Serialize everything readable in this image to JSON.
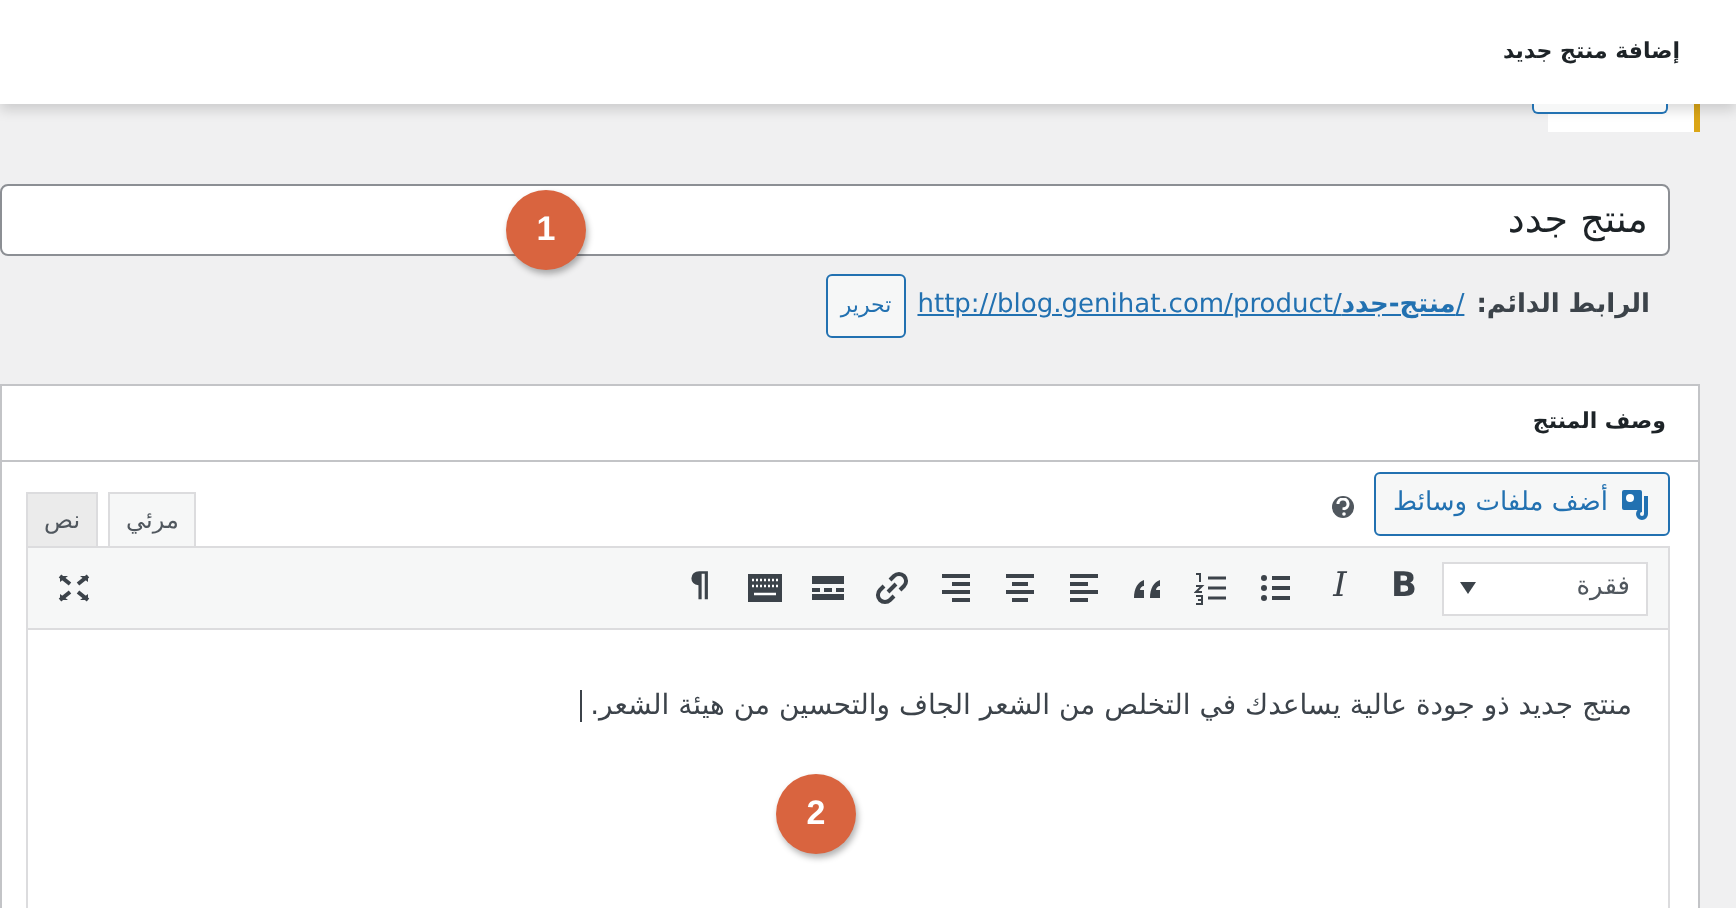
{
  "header": {
    "title": "إضافة منتج جديد"
  },
  "title_field": {
    "value": "منتج جدد"
  },
  "permalink": {
    "label": "الرابط الدائم:",
    "url": "http://blog.genihat.com/product/**منتج-جدد**/",
    "edit_button": "تحرير"
  },
  "postbox": {
    "title": "وصف المنتج",
    "media_button": "أضف ملفات وسائط",
    "tabs": [
      {
        "label": "مرئي",
        "selected": true
      },
      {
        "label": "نص",
        "selected": false
      }
    ],
    "format_select": "فقرة",
    "toolbar": [
      {
        "kind": "bold",
        "glyph": "B"
      },
      {
        "kind": "italic",
        "glyph": "I"
      },
      {
        "kind": "bullet-list"
      },
      {
        "kind": "numbered-list"
      },
      {
        "kind": "quote"
      },
      {
        "kind": "align-left"
      },
      {
        "kind": "align-center"
      },
      {
        "kind": "align-right"
      },
      {
        "kind": "link"
      },
      {
        "kind": "read-more"
      },
      {
        "kind": "keyboard"
      },
      {
        "kind": "pilcrow",
        "glyph": "¶"
      }
    ],
    "content": "منتج جديد ذو جودة عالية يساعدك في التخلص من الشعر الجاف والتحسين من هيئة الشعر."
  },
  "markers": [
    "1",
    "2"
  ]
}
